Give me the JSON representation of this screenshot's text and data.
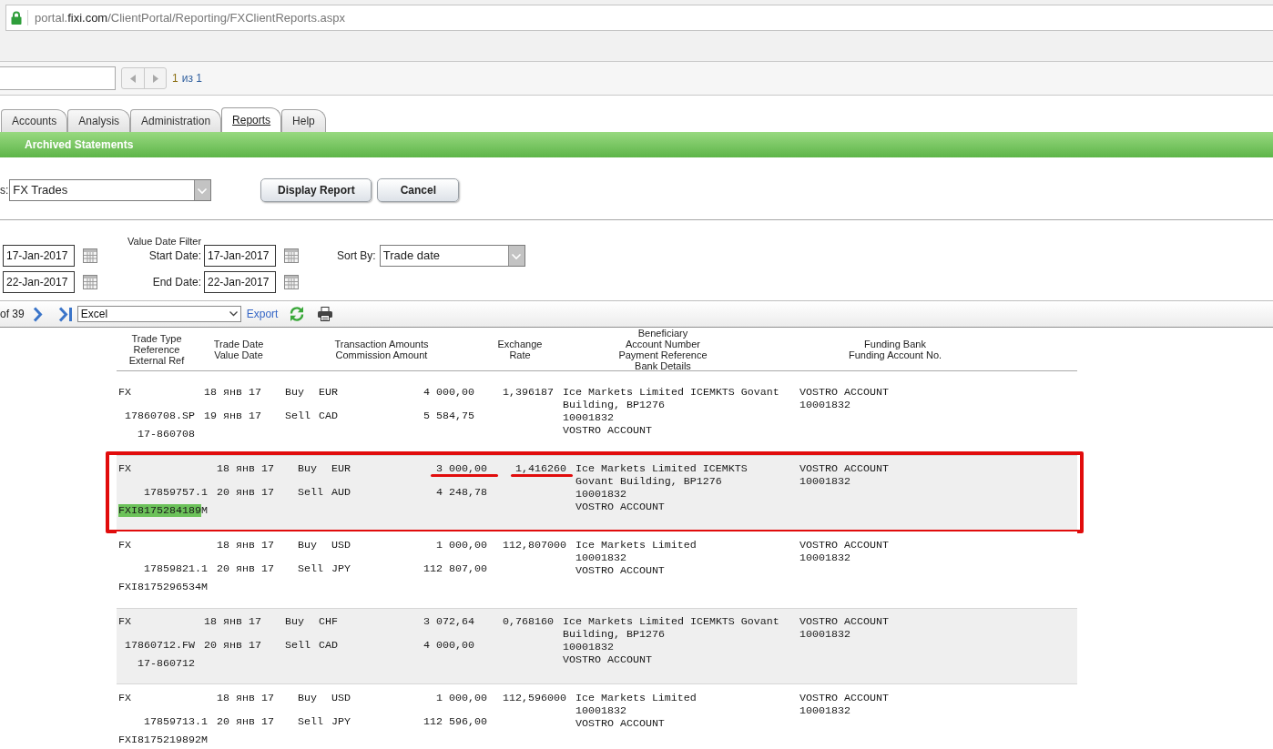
{
  "address_bar": {
    "url": {
      "subdomain": "portal.",
      "domain": "fixi.com",
      "path": "/ClientPortal/Reporting/FXClientReports.aspx"
    }
  },
  "viewer_toolbar": {
    "page_buttons": [
      {
        "kind": "previous",
        "disabled": true
      },
      {
        "kind": "next",
        "disabled": true
      }
    ],
    "page_number": "1",
    "page_count": "из 1"
  },
  "tabs": [
    {
      "label": "Accounts",
      "selected": false
    },
    {
      "label": "Analysis",
      "selected": false
    },
    {
      "label": "Administration",
      "selected": false
    },
    {
      "label": "Reports",
      "selected": true
    },
    {
      "label": "Help",
      "selected": false
    }
  ],
  "subnav": {
    "items": [
      {
        "label": "Archived Statements"
      }
    ]
  },
  "report_form": {
    "label": "s:",
    "report_select": {
      "value": "FX Trades"
    },
    "buttons": [
      {
        "label": "Display Report"
      },
      {
        "label": "Cancel"
      }
    ]
  },
  "filters": {
    "title": "Value Date Filter",
    "rows": [
      {
        "date": "17-Jan-2017",
        "label": "Start Date:",
        "value_date": "17-Jan-2017"
      },
      {
        "date": "22-Jan-2017",
        "label": "End Date:",
        "value_date": "22-Jan-2017"
      }
    ],
    "sort_by": {
      "label": "Sort By:",
      "value": "Trade date"
    }
  },
  "report_toolbar": {
    "page_of": "of 39",
    "export_format": "Excel",
    "export_link": "Export"
  },
  "report": {
    "columns": [
      {
        "lines": [
          "Trade Type",
          "Reference",
          "External Ref"
        ]
      },
      {
        "lines": [
          "Trade Date",
          "Value Date"
        ]
      },
      {
        "lines": [
          "Transaction Amounts",
          "Commission Amount"
        ]
      },
      {
        "lines": [
          "Exchange",
          "Rate"
        ]
      },
      {
        "lines": [
          "Beneficiary",
          "Account Number",
          "Payment Reference",
          "Bank Details"
        ]
      },
      {
        "lines": [
          "Funding Bank",
          "Funding Account No."
        ]
      }
    ],
    "rows": [
      {
        "type": "FX",
        "reference": "17860708.SP",
        "external_ref": [
          {
            "text": "17-860708",
            "highlighted": false
          }
        ],
        "trade_date": "18 янв 17",
        "value_date": "19 янв 17",
        "legs": [
          {
            "side": "Buy",
            "currency": "EUR",
            "amount": "4 000,00",
            "underlined": false
          },
          {
            "side": "Sell",
            "currency": "CAD",
            "amount": "5 584,75",
            "underlined": false
          }
        ],
        "rate": "1,396187",
        "rate_underlined": false,
        "beneficiary": [
          "Ice Markets Limited ICEMKTS Govant",
          "Building, BP1276",
          "10001832",
          "VOSTRO ACCOUNT"
        ],
        "funding": [
          "VOSTRO ACCOUNT",
          "10001832"
        ],
        "shaded": false,
        "outlined": false
      },
      {
        "type": "FX",
        "reference": "17859757.1",
        "external_ref": [
          {
            "text": "FXI8175284189",
            "highlighted": true
          },
          {
            "text": "M",
            "highlighted": false
          }
        ],
        "trade_date": "18 янв 17",
        "value_date": "20 янв 17",
        "legs": [
          {
            "side": "Buy",
            "currency": "EUR",
            "amount": "3 000,00",
            "underlined": true
          },
          {
            "side": "Sell",
            "currency": "AUD",
            "amount": "4 248,78",
            "underlined": false
          }
        ],
        "rate": "1,416260",
        "rate_underlined": true,
        "beneficiary": [
          "Ice Markets Limited ICEMKTS",
          "Govant Building, BP1276",
          "10001832",
          "VOSTRO ACCOUNT"
        ],
        "funding": [
          "VOSTRO ACCOUNT",
          "10001832"
        ],
        "shaded": true,
        "outlined": true
      },
      {
        "type": "FX",
        "reference": "17859821.1",
        "external_ref": [
          {
            "text": "FXI8175296534M",
            "highlighted": false
          }
        ],
        "trade_date": "18 янв 17",
        "value_date": "20 янв 17",
        "legs": [
          {
            "side": "Buy",
            "currency": "USD",
            "amount": "1 000,00",
            "underlined": false
          },
          {
            "side": "Sell",
            "currency": "JPY",
            "amount": "112 807,00",
            "underlined": false
          }
        ],
        "rate": "112,807000",
        "rate_underlined": false,
        "beneficiary": [
          "Ice Markets Limited",
          "10001832",
          "VOSTRO ACCOUNT"
        ],
        "funding": [
          "VOSTRO ACCOUNT",
          "10001832"
        ],
        "shaded": false,
        "outlined": false
      },
      {
        "type": "FX",
        "reference": "17860712.FW",
        "external_ref": [
          {
            "text": "17-860712",
            "highlighted": false
          }
        ],
        "trade_date": "18 янв 17",
        "value_date": "20 янв 17",
        "legs": [
          {
            "side": "Buy",
            "currency": "CHF",
            "amount": "3 072,64",
            "underlined": false
          },
          {
            "side": "Sell",
            "currency": "CAD",
            "amount": "4 000,00",
            "underlined": false
          }
        ],
        "rate": "0,768160",
        "rate_underlined": false,
        "beneficiary": [
          "Ice Markets Limited ICEMKTS Govant",
          "Building, BP1276",
          "10001832",
          "VOSTRO ACCOUNT"
        ],
        "funding": [
          "VOSTRO ACCOUNT",
          "10001832"
        ],
        "shaded": true,
        "outlined": false
      },
      {
        "type": "FX",
        "reference": "17859713.1",
        "external_ref": [
          {
            "text": "FXI8175219892M",
            "highlighted": false
          }
        ],
        "trade_date": "18 янв 17",
        "value_date": "20 янв 17",
        "legs": [
          {
            "side": "Buy",
            "currency": "USD",
            "amount": "1 000,00",
            "underlined": false
          },
          {
            "side": "Sell",
            "currency": "JPY",
            "amount": "112 596,00",
            "underlined": false
          }
        ],
        "rate": "112,596000",
        "rate_underlined": false,
        "beneficiary": [
          "Ice Markets Limited",
          "10001832",
          "VOSTRO ACCOUNT"
        ],
        "funding": [
          "VOSTRO ACCOUNT",
          "10001832"
        ],
        "shaded": false,
        "outlined": false
      }
    ]
  }
}
